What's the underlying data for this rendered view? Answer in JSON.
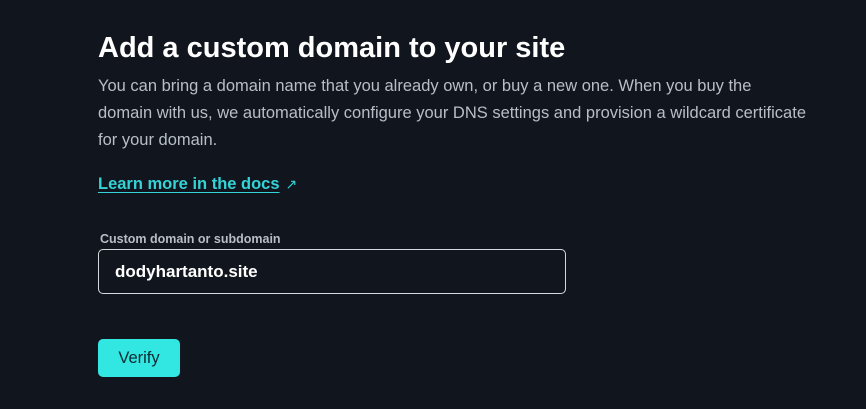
{
  "heading": "Add a custom domain to your site",
  "description": "You can bring a domain name that you already own, or buy a new one. When you buy the domain with us, we automatically configure your DNS settings and provision a wildcard certificate for your domain.",
  "docs_link": {
    "label": "Learn more in the docs",
    "icon": "external-arrow-icon"
  },
  "domain_field": {
    "label": "Custom domain or subdomain",
    "value": "dodyhartanto.site"
  },
  "verify_button": {
    "label": "Verify"
  },
  "colors": {
    "background": "#11161e",
    "accent": "#32e6e2",
    "link": "#33d3d6",
    "muted_text": "#b8bec7"
  }
}
